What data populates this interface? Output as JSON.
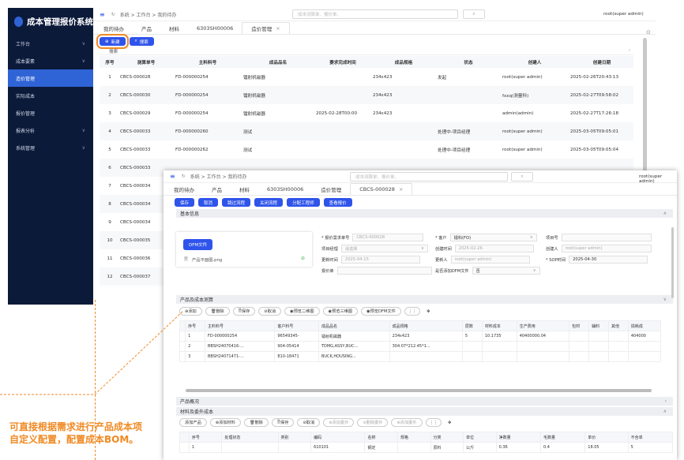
{
  "app": {
    "title": "成本管理报价系统"
  },
  "sidebar": {
    "items": [
      "工作台",
      "成本要素",
      "造价管理",
      "实际成本",
      "报价管理",
      "报表分析",
      "系统管理"
    ]
  },
  "header": {
    "breadcrumb": "系统 > 工作台 > 我的待办",
    "search_placeholder": "成本测算单、报价单、",
    "user": "root(super admin)"
  },
  "tabs1": [
    "我的待办",
    "产品",
    "材料",
    "6303SH00006",
    "造价管理"
  ],
  "toolbar1": {
    "new": "新建",
    "search": "搜索"
  },
  "search_bar": "搜索",
  "table1": {
    "columns": [
      "序号",
      "测算单号",
      "主料料号",
      "成品品名",
      "要求完成时间",
      "成品规格",
      "状态",
      "创建人",
      "创建日期"
    ],
    "rows": [
      [
        "1",
        "CBCS-000028",
        "FD-000000254",
        "镭射机磁器",
        "",
        "234ε423",
        "发起",
        "root(super admin)",
        "2025-02-26T20:43:13"
      ],
      [
        "2",
        "CBCS-000030",
        "FD-000000254",
        "镭射机磁器",
        "",
        "234ε423",
        "",
        "fxxq(测量科)",
        "2025-02-27T09:58:02"
      ],
      [
        "3",
        "CBCS-000029",
        "FD-000000254",
        "镭射机磁器",
        "2025-02-28T00:00",
        "234ε423",
        "",
        "admin(admin)",
        "2025-02-27T17:26:18"
      ],
      [
        "4",
        "CBCS-000033",
        "FD-000000260",
        "测试",
        "",
        "",
        "处理中-项目经理",
        "root(super admin)",
        "2025-03-05T09:05:01"
      ],
      [
        "5",
        "CBCS-000033",
        "FD-000000262",
        "测试",
        "",
        "",
        "处理中-项目经理",
        "root(super admin)",
        "2025-03-05T09:05:04"
      ],
      [
        "6",
        "CBCS-000033",
        "",
        "",
        "",
        "",
        "",
        "",
        ""
      ],
      [
        "7",
        "CBCS-000034",
        "",
        "",
        "",
        "",
        "",
        "",
        ""
      ],
      [
        "8",
        "CBCS-000034",
        "",
        "",
        "",
        "",
        "",
        "",
        ""
      ],
      [
        "9",
        "CBCS-000034",
        "",
        "",
        "",
        "",
        "",
        "",
        ""
      ],
      [
        "10",
        "CBCS-000035",
        "",
        "",
        "",
        "",
        "",
        "",
        ""
      ],
      [
        "11",
        "CBCS-000036",
        "",
        "",
        "",
        "",
        "",
        "",
        ""
      ],
      [
        "12",
        "CBCS-000037",
        "",
        "",
        "",
        "",
        "",
        "",
        ""
      ]
    ]
  },
  "win2": {
    "breadcrumb": "系统 > 工作台 > 我的待办",
    "search_placeholder": "成本测算单、报价单、",
    "user": "root(super admin)",
    "tabs": [
      "我的待办",
      "产品",
      "材料",
      "6303SH00006",
      "造价管理",
      "CBCS-000028"
    ],
    "actions": [
      "保存",
      "取消",
      "跳过流程",
      "关闭流程",
      "分配工程师",
      "查看报价"
    ],
    "sections": {
      "basic": "基本信息",
      "cost": "产品及成本测算",
      "overview": "产品概况",
      "material": "材料及委外成本"
    },
    "dfm": {
      "button": "DFM文件",
      "file": "产品平面图.png"
    },
    "fields": {
      "quote_no": {
        "label": "* 报价需求单号",
        "value": "CBCS-000028"
      },
      "customer": {
        "label": "* 客户",
        "value": "镭科(FO)"
      },
      "project_no": {
        "label": "项目号",
        "value": ""
      },
      "manager": {
        "label": "项目经理",
        "value": "请选择"
      },
      "created_at": {
        "label": "创建时间",
        "value": "2025-02-26"
      },
      "creator": {
        "label": "创建人",
        "value": "root(super admin)"
      },
      "updated_at": {
        "label": "更新时间",
        "value": "2025-04-15"
      },
      "updater": {
        "label": "更新人",
        "value": "root(super admin)"
      },
      "sop": {
        "label": "* SOP时间",
        "value": "2025-04-30"
      },
      "quote": {
        "label": "报价单",
        "value": ""
      },
      "dfm_flag": {
        "label": "是否添加DFM文件",
        "value": "否"
      }
    },
    "cost_toolbar": [
      "添加",
      "删除",
      "保存",
      "取消",
      "预览二维图",
      "预览三维图",
      "预览DFM文件"
    ],
    "cost_table": {
      "columns": [
        "",
        "序号",
        "主料料号",
        "客户料号",
        "成品品名",
        "成品规格",
        "层数",
        "材料成本",
        "生产费用",
        "包材",
        "辅料",
        "其他",
        "损耗成"
      ],
      "rows": [
        [
          "",
          "1",
          "FD-000000254",
          "96549345-",
          "镭射机磁器",
          "234ε423",
          "5",
          "10.1735",
          "40400000.04",
          "",
          "",
          "",
          "404000"
        ],
        [
          "",
          "2",
          "BBSH24070416-...",
          "904-05414",
          "TDMG,ASSY,BUC...",
          "304.07*212.45*1...",
          "",
          "",
          "",
          "",
          "",
          "",
          ""
        ],
        [
          "",
          "3",
          "BBSH24071471-...",
          "810-18471",
          "BUCK,HOUSING...",
          "",
          "",
          "",
          "",
          "",
          "",
          "",
          ""
        ]
      ]
    },
    "mat_toolbar": [
      "添加产品",
      "添加材料",
      "删除",
      "保存",
      "取消",
      "添加委外",
      "删除委外",
      "添加委外"
    ],
    "mat_table": {
      "columns": [
        "",
        "序号",
        "处理状态",
        "类别",
        "编码",
        "名称",
        "规格",
        "分类",
        "单位",
        "净数量",
        "毛数量",
        "单价",
        "不含单"
      ],
      "rows": [
        [
          "",
          "1",
          "",
          "",
          "610101",
          "钢定",
          "",
          "原料",
          "公斤",
          "0.36",
          "0.4",
          "18.05",
          "5"
        ]
      ]
    }
  },
  "annotation": {
    "line1": "可直接根据需求进行产品成本项",
    "line2": "自定义配置，配置成本BOM。"
  },
  "colors": {
    "accent": "#2f54eb",
    "sidebar": "#0c1a3a",
    "annotation": "#f08a24"
  }
}
